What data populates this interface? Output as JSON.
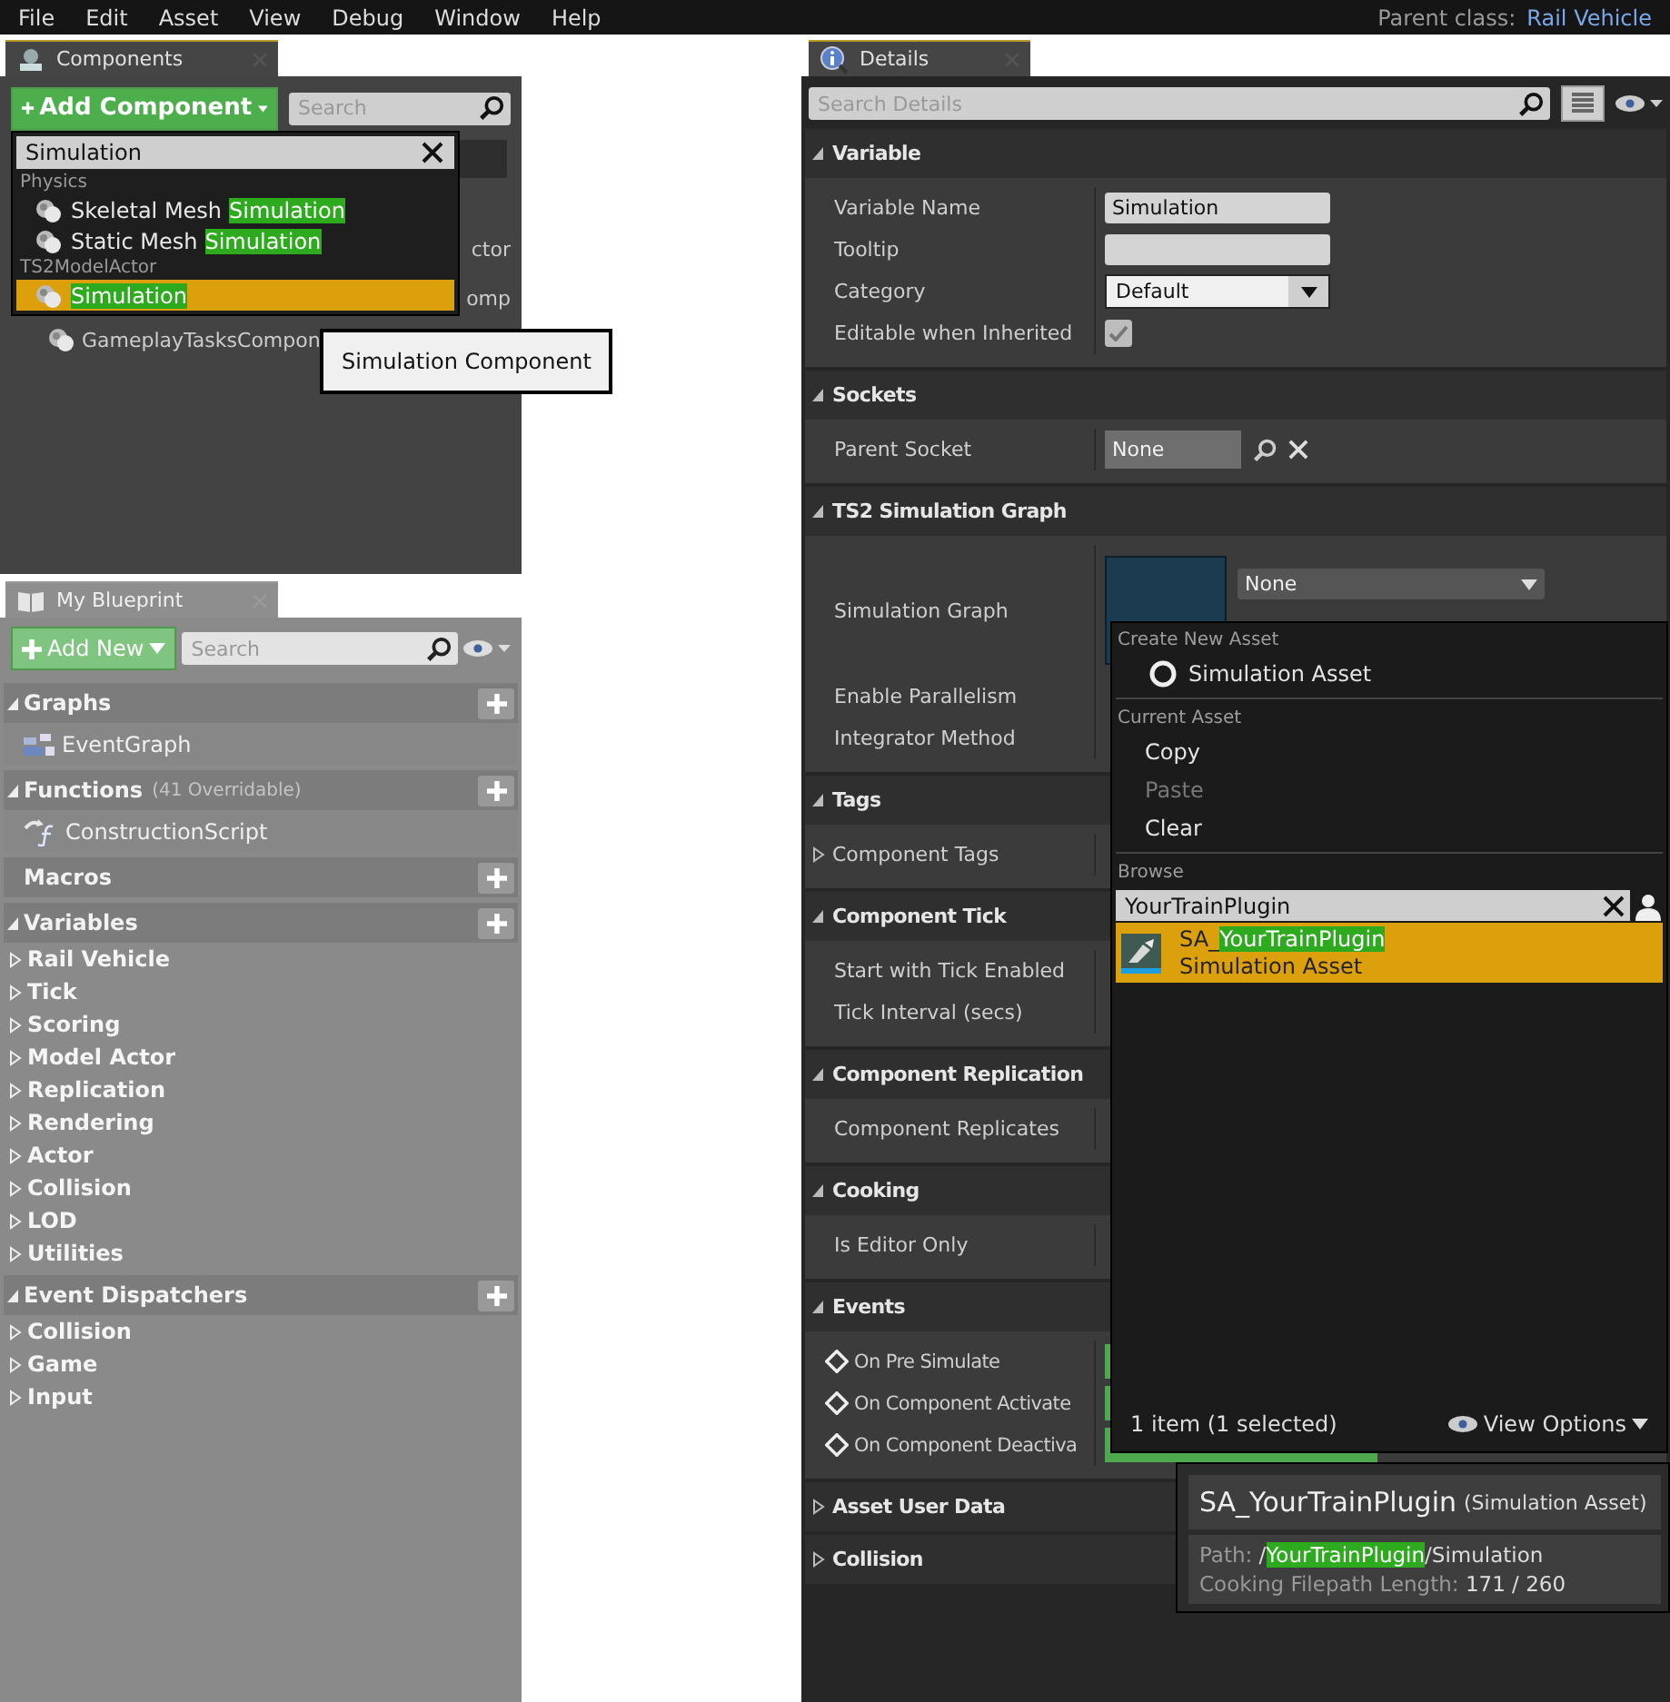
{
  "menu_bar": {
    "items": [
      "File",
      "Edit",
      "Asset",
      "View",
      "Debug",
      "Window",
      "Help"
    ],
    "parent_class_label": "Parent class:",
    "parent_class": "Rail Vehicle"
  },
  "components_panel": {
    "tab": "Components",
    "add_button": "Add Component",
    "search_placeholder": "Search",
    "tree_rows": [
      {
        "kind": "fragment",
        "text": "ctor"
      },
      {
        "kind": "fragment",
        "text": "omp"
      },
      {
        "kind": "item",
        "text": "GameplayTasksCompon"
      }
    ],
    "add_menu": {
      "query": "Simulation",
      "groups": [
        {
          "label": "Physics",
          "items": [
            {
              "prefix": "Skeletal Mesh ",
              "match": "Simulation",
              "selected": false
            },
            {
              "prefix": "Static Mesh ",
              "match": "Simulation",
              "selected": false
            }
          ]
        },
        {
          "label": "TS2ModelActor",
          "items": [
            {
              "match": "Simulation",
              "selected": true
            }
          ]
        }
      ]
    },
    "tooltip": "Simulation Component"
  },
  "my_blueprint": {
    "tab": "My Blueprint",
    "add_button": "Add New",
    "search_placeholder": "Search",
    "sections": [
      {
        "title": "Graphs",
        "expanded": true,
        "items": [
          {
            "kind": "graph",
            "label": "EventGraph"
          }
        ]
      },
      {
        "title": "Functions",
        "note": "(41 Overridable)",
        "expanded": true,
        "items": [
          {
            "kind": "function",
            "label": "ConstructionScript"
          }
        ]
      },
      {
        "title": "Macros"
      },
      {
        "title": "Variables",
        "expanded": true,
        "items": [
          {
            "kind": "category",
            "label": "Rail Vehicle",
            "expanded": false
          },
          {
            "kind": "category",
            "label": "Tick",
            "expanded": false
          },
          {
            "kind": "category",
            "label": "Scoring",
            "expanded": false
          },
          {
            "kind": "category",
            "label": "Model Actor",
            "expanded": false
          },
          {
            "kind": "category",
            "label": "Replication",
            "expanded": false
          },
          {
            "kind": "category",
            "label": "Rendering",
            "expanded": false
          },
          {
            "kind": "category",
            "label": "Actor",
            "expanded": false
          },
          {
            "kind": "category",
            "label": "Collision",
            "expanded": false
          },
          {
            "kind": "category",
            "label": "LOD",
            "expanded": false
          },
          {
            "kind": "category",
            "label": "Utilities",
            "expanded": false
          }
        ]
      },
      {
        "title": "Event Dispatchers",
        "expanded": true,
        "items": [
          {
            "kind": "category",
            "label": "Collision",
            "expanded": false
          },
          {
            "kind": "category",
            "label": "Game",
            "expanded": false
          },
          {
            "kind": "category",
            "label": "Input",
            "expanded": false
          }
        ]
      }
    ]
  },
  "details": {
    "tab": "Details",
    "search_placeholder": "Search Details",
    "sections": [
      {
        "title": "Variable",
        "expanded": true,
        "rows": [
          {
            "kind": "text",
            "label": "Variable Name",
            "value": "Simulation"
          },
          {
            "kind": "text",
            "label": "Tooltip"
          },
          {
            "kind": "combo",
            "label": "Category",
            "value": "Default"
          },
          {
            "kind": "checkbox",
            "label": "Editable when Inherited",
            "checked": true
          }
        ]
      },
      {
        "title": "Sockets",
        "expanded": true,
        "rows": [
          {
            "kind": "socket",
            "label": "Parent Socket",
            "value": "None"
          }
        ]
      },
      {
        "title": "TS2 Simulation Graph",
        "expanded": true,
        "rows": [
          {
            "kind": "asset",
            "label": "Simulation Graph",
            "value": "None"
          },
          {
            "kind": "covered",
            "label": "Enable Parallelism"
          },
          {
            "kind": "covered",
            "label": "Integrator Method"
          }
        ]
      },
      {
        "title": "Tags",
        "expanded": true,
        "rows": [
          {
            "kind": "array",
            "label": "Component Tags",
            "expanded": false
          }
        ]
      },
      {
        "title": "Component Tick",
        "expanded": true,
        "rows": [
          {
            "kind": "covered",
            "label": "Start with Tick Enabled"
          },
          {
            "kind": "covered",
            "label": "Tick Interval (secs)"
          }
        ]
      },
      {
        "title": "Component Replication",
        "expanded": true,
        "rows": [
          {
            "kind": "covered",
            "label": "Component Replicates"
          }
        ]
      },
      {
        "title": "Cooking",
        "expanded": true,
        "rows": [
          {
            "kind": "covered",
            "label": "Is Editor Only"
          }
        ]
      },
      {
        "title": "Events",
        "expanded": true,
        "rows": [
          {
            "kind": "event",
            "label": "On Pre Simulate"
          },
          {
            "kind": "event",
            "label": "On Component Activate"
          },
          {
            "kind": "event",
            "label": "On Component Deactiva"
          }
        ]
      },
      {
        "title": "Asset User Data",
        "expanded": false
      },
      {
        "title": "Collision",
        "expanded": false
      }
    ]
  },
  "asset_picker": {
    "create_heading": "Create New Asset",
    "create_item": "Simulation Asset",
    "current_heading": "Current Asset",
    "actions": [
      {
        "label": "Copy",
        "disabled": false
      },
      {
        "label": "Paste",
        "disabled": true
      },
      {
        "label": "Clear",
        "disabled": false
      }
    ],
    "browse_heading": "Browse",
    "filter": "YourTrainPlugin",
    "results": [
      {
        "prefix": "SA_",
        "match": "YourTrainPlugin",
        "type": "Simulation Asset",
        "selected": true
      }
    ],
    "status": "1 item (1 selected)",
    "view_options": "View Options"
  },
  "asset_tooltip": {
    "name": "SA_YourTrainPlugin",
    "type": "(Simulation Asset)",
    "path_label": "Path:",
    "path_prefix": "/",
    "path_match": "YourTrainPlugin",
    "path_suffix": "/Simulation",
    "cooking_label": "Cooking Filepath Length:",
    "cooking_value": "171 / 260"
  }
}
